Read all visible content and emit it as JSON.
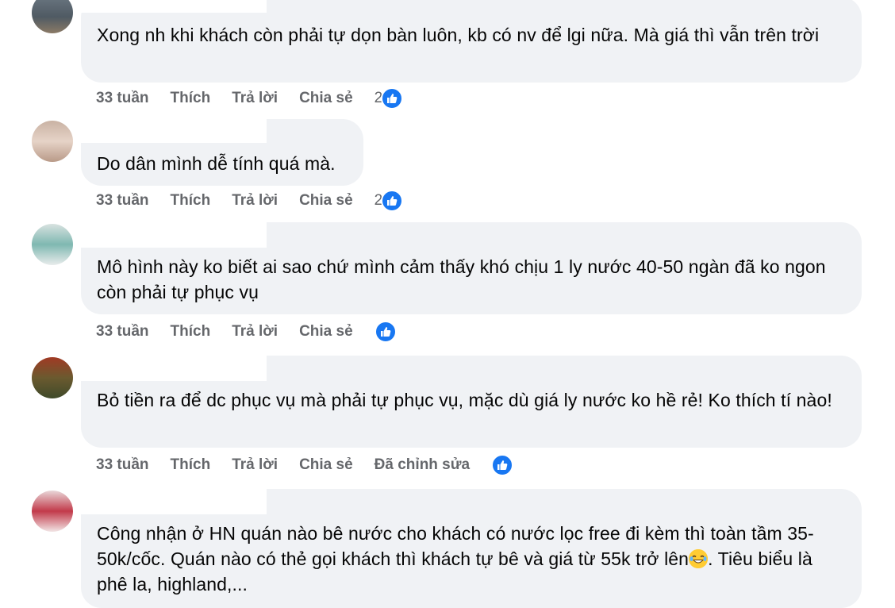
{
  "colors": {
    "bubble": "#f0f2f5",
    "meta_text": "#65676b",
    "like_blue": "#1877f2"
  },
  "comments": [
    {
      "text": "Xong nh khi khách còn phải tự dọn bàn luôn, kb có nv để lgi nữa. Mà giá thì vẫn trên trời",
      "time": "33 tuần",
      "like": "Thích",
      "reply": "Trả lời",
      "share": "Chia sẻ",
      "reactions": "2"
    },
    {
      "text": "Do dân mình dễ tính quá mà.",
      "time": "33 tuần",
      "like": "Thích",
      "reply": "Trả lời",
      "share": "Chia sẻ",
      "reactions": "2"
    },
    {
      "text": "Mô hình này ko biết ai sao chứ mình cảm thấy khó chịu 1 ly nước 40-50 ngàn đã ko ngon còn phải tự phục vụ",
      "time": "33 tuần",
      "like": "Thích",
      "reply": "Trả lời",
      "share": "Chia sẻ",
      "reactions": ""
    },
    {
      "text": "Bỏ tiền ra để dc phục vụ mà phải tự phục vụ, mặc dù giá ly nước ko hề rẻ! Ko thích tí nào!",
      "time": "33 tuần",
      "like": "Thích",
      "reply": "Trả lời",
      "share": "Chia sẻ",
      "edited": "Đã chỉnh sửa",
      "reactions": ""
    },
    {
      "text_before_emoji": "Công nhận ở HN quán nào bê nước cho khách có nước lọc free đi kèm thì toàn tầm 35-50k/cốc. Quán nào có thẻ gọi khách thì khách tự bê và giá từ 55k trở lên",
      "emoji": "laughing-emoji",
      "text_after_emoji": ". Tiêu biểu là phê la, highland,..."
    }
  ]
}
